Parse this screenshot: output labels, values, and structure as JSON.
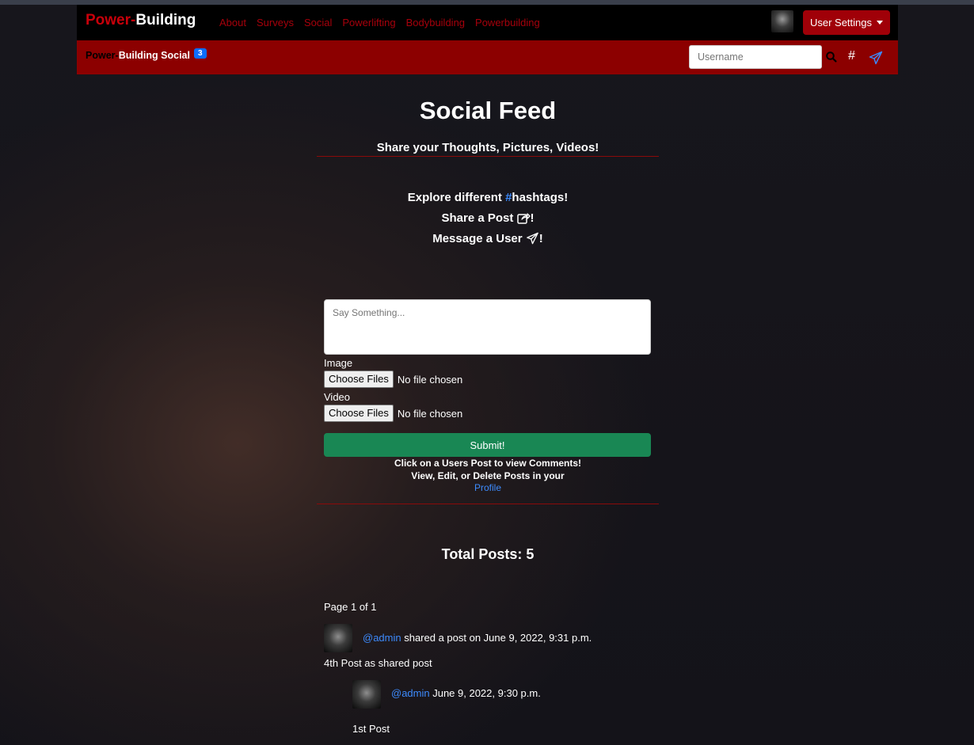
{
  "navbar": {
    "brand_part1": "Power-",
    "brand_part2": "Building",
    "links": [
      "About",
      "Surveys",
      "Social",
      "Powerlifting",
      "Bodybuilding",
      "Powerbuilding"
    ],
    "settings_label": "User Settings"
  },
  "subbar": {
    "brand_part1": "Power-",
    "brand_part2": "Building Social",
    "badge_count": "3",
    "username_placeholder": "Username",
    "hash_symbol": "#"
  },
  "header": {
    "title": "Social Feed",
    "subtitle": "Share your Thoughts, Pictures, Videos!"
  },
  "explore": {
    "line1_prefix": "Explore different ",
    "line1_hash": "#",
    "line1_suffix": "hashtags!",
    "line2": "Share a Post",
    "line3": "Message a User",
    "exclaim": "!"
  },
  "form": {
    "textarea_placeholder": "Say Something...",
    "image_label": "Image",
    "video_label": "Video",
    "choose_label": "Choose Files",
    "no_file": "No file chosen",
    "submit_label": "Submit!"
  },
  "help": {
    "line1": "Click on a Users Post to view Comments!",
    "line2": "View, Edit, or Delete Posts in your",
    "profile_link": "Profile"
  },
  "feed": {
    "total_posts": "Total Posts: 5",
    "page_info": "Page 1 of 1",
    "posts": [
      {
        "user": "@admin",
        "meta": " shared a post on June 9, 2022, 9:31 p.m.",
        "text": "4th Post as shared post",
        "shared": {
          "user": "@admin",
          "meta": " June 9, 2022, 9:30 p.m.",
          "text": "1st Post"
        }
      }
    ]
  },
  "colors": {
    "brand_red": "#c8000a",
    "subbar_red": "#8c0000",
    "link_blue": "#3d8bfd",
    "submit_green": "#198754"
  }
}
